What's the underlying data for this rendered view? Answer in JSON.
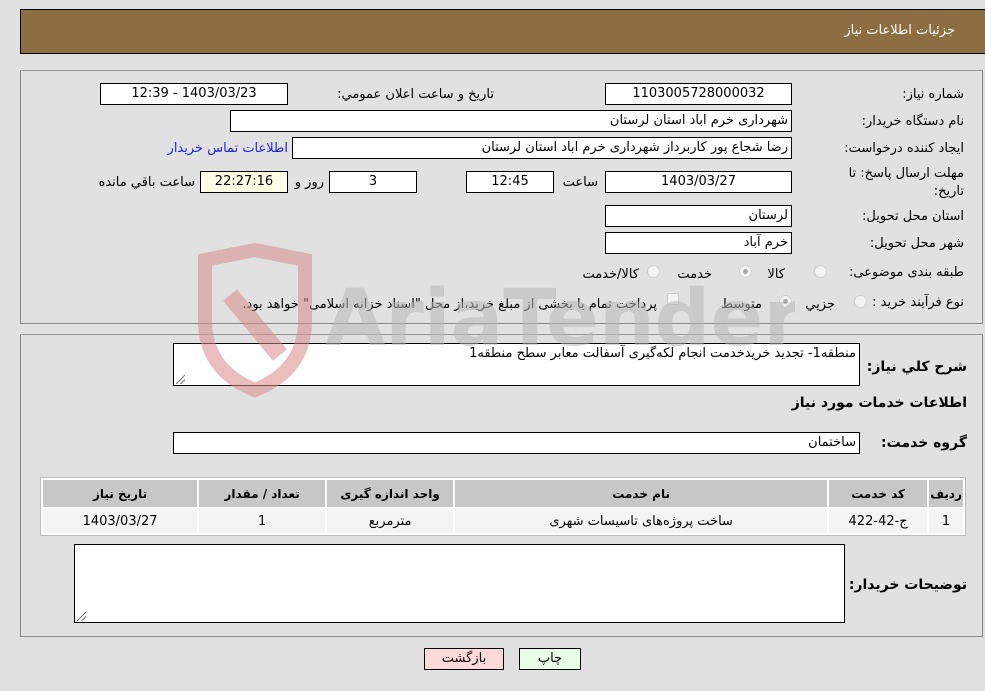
{
  "header": {
    "title": "جزئیات اطلاعات نیاز"
  },
  "form": {
    "need_number_label": "شماره نیاز:",
    "need_number": "1103005728000032",
    "announce_label": "تاریخ و ساعت اعلان عمومي:",
    "announce_value": "1403/03/23 - 12:39",
    "buyer_org_label": "نام دستگاه خریدار:",
    "buyer_org": "شهرداری خرم اباد استان لرستان",
    "creator_label": "ایجاد کننده درخواست:",
    "creator": "رضا شجاع پور کاربرداز شهرداری خرم اباد استان لرستان",
    "contact_link": "اطلاعات تماس خریدار",
    "deadline_label": "مهلت ارسال پاسخ: تا تاریخ:",
    "deadline_date": "1403/03/27",
    "time_label": "ساعت",
    "deadline_time": "12:45",
    "days_value": "3",
    "days_label": "روز و",
    "remaining_time": "22:27:16",
    "remaining_label": "ساعت باقي مانده",
    "province_label": "استان محل تحویل:",
    "province": "لرستان",
    "city_label": "شهر محل تحویل:",
    "city": "خرم آباد",
    "category_label": "طبقه بندی موضوعی:",
    "category_options": [
      "کالا",
      "خدمت",
      "کالا/خدمت"
    ],
    "category_selected": "خدمت",
    "purchase_type_label": "نوع فرآیند خرید :",
    "purchase_options": [
      "جزيي",
      "متوسط"
    ],
    "purchase_selected": "متوسط",
    "treasury_note": "پرداخت تمام یا بخشی از مبلغ خرید،از محل \"اسناد خزانه اسلامی\" خواهد بود."
  },
  "details": {
    "summary_label": "شرح کلي نیاز:",
    "summary": "منطقه1- تجدید خریدخدمت انجام لکه‌گیری آسفالت معابر سطح منطقه1",
    "services_heading": "اطلاعات خدمات مورد نیاز",
    "service_group_label": "گروه خدمت:",
    "service_group": "ساختمان",
    "table": {
      "headers": [
        "ردیف",
        "کد خدمت",
        "نام خدمت",
        "واحد اندازه گیری",
        "تعداد / مقدار",
        "تاریخ نیاز"
      ],
      "rows": [
        [
          "1",
          "ج-42-422",
          "ساخت پروژه‌های تاسیسات شهری",
          "مترمربع",
          "1",
          "1403/03/27"
        ]
      ]
    },
    "buyer_notes_label": "توضیحات خریدار:",
    "buyer_notes": ""
  },
  "buttons": {
    "print": "چاپ",
    "back": "بازگشت"
  },
  "watermark": {
    "text": "AriaTender.neT"
  }
}
